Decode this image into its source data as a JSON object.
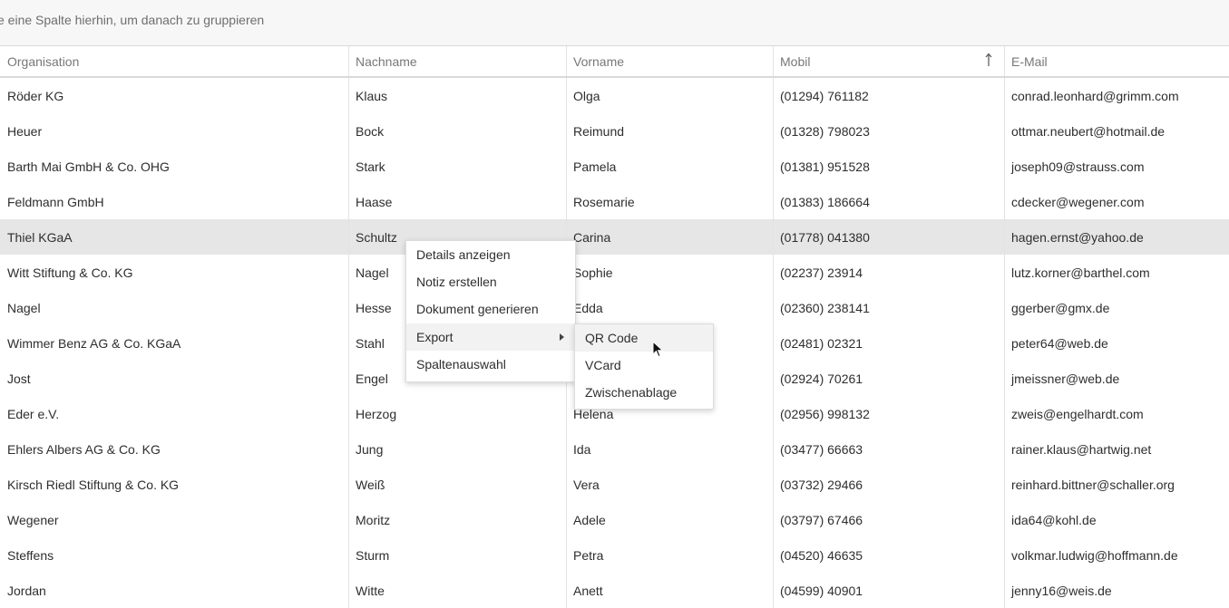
{
  "group_bar": {
    "text": "e eine Spalte hierhin, um danach zu gruppieren"
  },
  "columns": [
    "Organisation",
    "Nachname",
    "Vorname",
    "Mobil",
    "E-Mail"
  ],
  "sort": {
    "column": "Mobil",
    "direction": "ascending",
    "icon": "arrow-up-icon"
  },
  "rows": [
    [
      "Röder KG",
      "Klaus",
      "Olga",
      "(01294) 761182",
      "conrad.leonhard@grimm.com"
    ],
    [
      "Heuer",
      "Bock",
      "Reimund",
      "(01328) 798023",
      "ottmar.neubert@hotmail.de"
    ],
    [
      "Barth Mai GmbH & Co. OHG",
      "Stark",
      "Pamela",
      "(01381) 951528",
      "joseph09@strauss.com"
    ],
    [
      "Feldmann GmbH",
      "Haase",
      "Rosemarie",
      "(01383) 186664",
      "cdecker@wegener.com"
    ],
    [
      "Thiel KGaA",
      "Schultz",
      "Carina",
      "(01778) 041380",
      "hagen.ernst@yahoo.de"
    ],
    [
      "Witt Stiftung & Co. KG",
      "Nagel",
      "Sophie",
      "(02237) 23914",
      "lutz.korner@barthel.com"
    ],
    [
      "Nagel",
      "Hesse",
      "Edda",
      "(02360) 238141",
      "ggerber@gmx.de"
    ],
    [
      "Wimmer Benz AG & Co. KGaA",
      "Stahl",
      "",
      "(02481) 02321",
      "peter64@web.de"
    ],
    [
      "Jost",
      "Engel",
      "",
      "(02924) 70261",
      "jmeissner@web.de"
    ],
    [
      "Eder e.V.",
      "Herzog",
      "Helena",
      "(02956) 998132",
      "zweis@engelhardt.com"
    ],
    [
      "Ehlers Albers AG & Co. KG",
      "Jung",
      "Ida",
      "(03477) 66663",
      "rainer.klaus@hartwig.net"
    ],
    [
      "Kirsch Riedl Stiftung & Co. KG",
      "Weiß",
      "Vera",
      "(03732) 29466",
      "reinhard.bittner@schaller.org"
    ],
    [
      "Wegener",
      "Moritz",
      "Adele",
      "(03797) 67466",
      "ida64@kohl.de"
    ],
    [
      "Steffens",
      "Sturm",
      "Petra",
      "(04520) 46635",
      "volkmar.ludwig@hoffmann.de"
    ],
    [
      "Jordan",
      "Witte",
      "Anett",
      "(04599) 40901",
      "jenny16@weis.de"
    ]
  ],
  "selected_row": 4,
  "context_menu": {
    "items": [
      "Details anzeigen",
      "Notiz erstellen",
      "Dokument generieren",
      "Export",
      "Spaltenauswahl"
    ],
    "submenu_parent": "Export",
    "submenu": [
      "QR Code",
      "VCard",
      "Zwischenablage"
    ],
    "hovered_submenu_item": "QR Code"
  },
  "colors": {
    "selected_row": "#e6e6e6",
    "hover_item": "#f2f2f2",
    "group_bar": "#f7f7f7"
  }
}
